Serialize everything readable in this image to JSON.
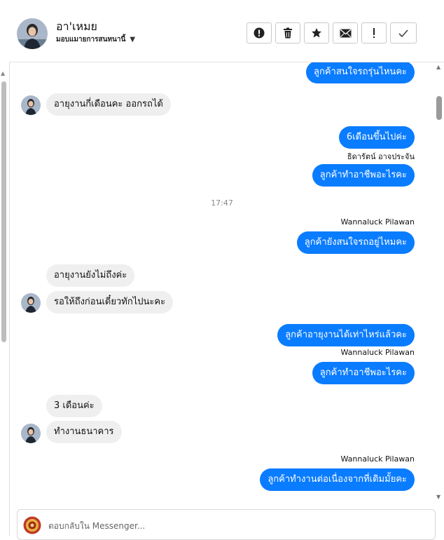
{
  "header": {
    "name": "อา'เหมย",
    "subtitle": "มอบแมายการสนทนานี้",
    "tools": [
      {
        "icon": "alert-circle-icon",
        "glyph": "!"
      },
      {
        "icon": "trash-icon",
        "glyph": ""
      },
      {
        "icon": "star-icon",
        "glyph": "★"
      },
      {
        "icon": "mail-icon",
        "glyph": "✉"
      },
      {
        "icon": "exclamation-icon",
        "glyph": "!"
      },
      {
        "icon": "check-icon",
        "glyph": "✓"
      }
    ]
  },
  "messages": {
    "m1": "ลูกค้าสนใจรถรุ่นไหนคะ",
    "m2": "อายุงานกี่เดือนคะ ออกรถได้",
    "m3": "6เดือนขึ้นไปค่ะ",
    "m3_sender": "ธิดารัตน์ อาจประจัน",
    "m4": "ลูกค้าทำอาชีพอะไรคะ",
    "time1": "17:47",
    "m5_sender": "Wannaluck Pilawan",
    "m5": "ลูกค้ายังสนใจรถอยู่ไหมคะ",
    "m6": "อายุงานยังไม่ถึงค่ะ",
    "m7": "รอให้ถึงก่อนเดี๋ยวทักไปนะคะ",
    "m8": "ลูกค้าอายุงานได้เท่าไหร่แล้วคะ",
    "m9_sender": "Wannaluck Pilawan",
    "m9": "ลูกค้าทำอาชีพอะไรคะ",
    "m10": "3 เดือนค่ะ",
    "m11": "ทำงานธนาคาร",
    "m12_sender": "Wannaluck Pilawan",
    "m12": "ลูกค้าทำงานต่อเนื่องจากที่เดิมมั้ยคะ"
  },
  "composer": {
    "placeholder": "ตอบกลับใน Messenger..."
  },
  "colors": {
    "outgoing_bubble": "#0a7cff",
    "incoming_bubble": "#efefef"
  }
}
